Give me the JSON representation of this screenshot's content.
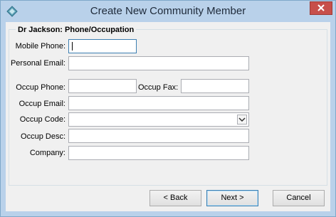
{
  "window": {
    "title": "Create New Community Member"
  },
  "section": {
    "heading": "Dr Jackson: Phone/Occupation"
  },
  "fields": {
    "mobile_phone": {
      "label": "Mobile Phone:",
      "value": ""
    },
    "personal_email": {
      "label": "Personal Email:",
      "value": ""
    },
    "occup_phone": {
      "label": "Occup Phone:",
      "value": ""
    },
    "occup_fax": {
      "label": "Occup Fax:",
      "value": ""
    },
    "occup_email": {
      "label": "Occup Email:",
      "value": ""
    },
    "occup_code": {
      "label": "Occup Code:",
      "value": ""
    },
    "occup_desc": {
      "label": "Occup Desc:",
      "value": ""
    },
    "company": {
      "label": "Company:",
      "value": ""
    }
  },
  "buttons": {
    "back": "< Back",
    "next": "Next >",
    "cancel": "Cancel"
  },
  "icons": {
    "app": "app-icon",
    "close": "close-icon",
    "dropdown": "chevron-down-icon"
  },
  "colors": {
    "titlebar": "#b9d1ea",
    "close_button": "#c74f4a",
    "focus_border": "#3c7fb1"
  }
}
